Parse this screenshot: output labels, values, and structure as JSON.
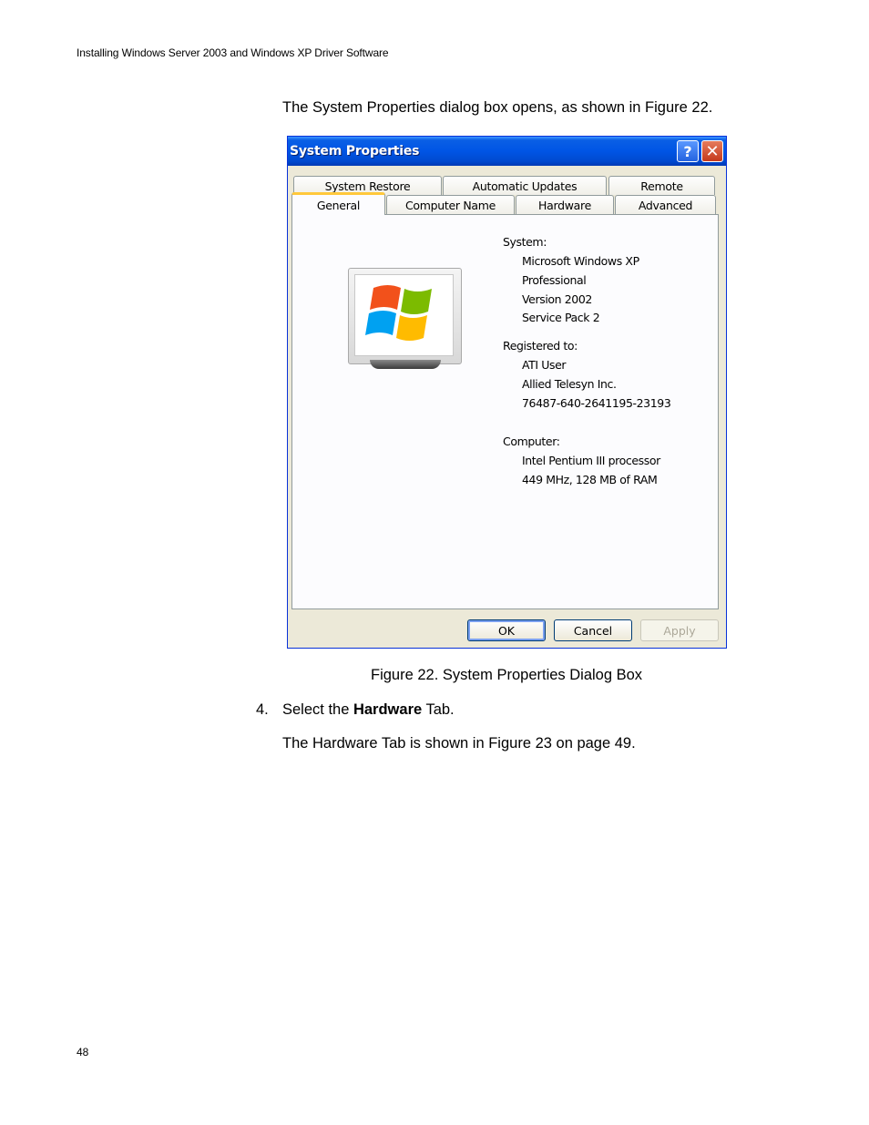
{
  "header": {
    "running_title": "Installing Windows Server 2003 and Windows XP Driver Software"
  },
  "body": {
    "intro": "The System Properties dialog box opens, as shown in Figure 22.",
    "caption": "Figure 22. System Properties Dialog Box",
    "step_number": "4.",
    "step_prefix": "Select the ",
    "step_bold": "Hardware",
    "step_suffix": " Tab.",
    "note": "The Hardware Tab is shown in Figure 23 on page 49."
  },
  "footer": {
    "page_number": "48"
  },
  "dialog": {
    "title": "System Properties",
    "help_glyph": "?",
    "close_glyph": "✕",
    "tabs_row1": [
      "System Restore",
      "Automatic Updates",
      "Remote"
    ],
    "tabs_row2": [
      "General",
      "Computer Name",
      "Hardware",
      "Advanced"
    ],
    "active_tab": "General",
    "system_label": "System:",
    "system_lines": [
      "Microsoft Windows XP",
      "Professional",
      "Version 2002",
      "Service Pack 2"
    ],
    "registered_label": "Registered to:",
    "registered_lines": [
      "ATI User",
      "Allied Telesyn Inc.",
      "76487-640-2641195-23193"
    ],
    "computer_label": "Computer:",
    "computer_lines": [
      "Intel Pentium III processor",
      "449 MHz, 128 MB of RAM"
    ],
    "buttons": {
      "ok": "OK",
      "cancel": "Cancel",
      "apply": "Apply"
    },
    "icon": "windows-xp-monitor-icon",
    "colors": {
      "titlebar": "#0055e5",
      "active_tab_accent": "#ffc83c",
      "face": "#ece9d8"
    }
  }
}
